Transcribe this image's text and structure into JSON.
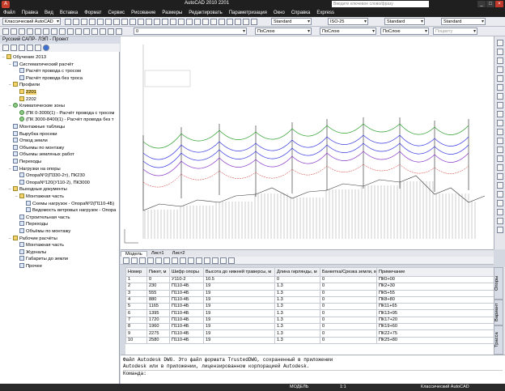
{
  "window": {
    "title": "AutoCAD 2010     2201",
    "search_placeholder": "Введите ключевое слово/фразу"
  },
  "menu": [
    "Файл",
    "Правка",
    "Вид",
    "Вставка",
    "Формат",
    "Сервис",
    "Рисование",
    "Размеры",
    "Редактировать",
    "Параметризация",
    "Окно",
    "Справка",
    "Express"
  ],
  "toolbar": {
    "workspace": "Классический AutoCAD",
    "text_style": "Standard",
    "dim_style": "ISO-25",
    "table_style": "Standard",
    "mleader_style": "Standard",
    "layer": "0",
    "color": "ПоСлою",
    "linetype": "ПоСлою",
    "lineweight": "ПоСлою",
    "plotstyle": "Поцвету"
  },
  "left_panel": {
    "title": "Русский САПР- ЛЭП - Проект",
    "tree": [
      {
        "level": 0,
        "icon": "folder",
        "label": "Обучение 2013",
        "exp": "−"
      },
      {
        "level": 1,
        "icon": "doc",
        "label": "Систематический расчёт",
        "exp": "−"
      },
      {
        "level": 2,
        "icon": "doc",
        "label": "Расчёт провода с тросом",
        "exp": ""
      },
      {
        "level": 2,
        "icon": "doc",
        "label": "Расчёт провода без троса",
        "exp": ""
      },
      {
        "level": 1,
        "icon": "folder",
        "label": "Профили",
        "exp": "−"
      },
      {
        "level": 2,
        "icon": "folder",
        "label": "2201",
        "exp": "",
        "sel": true
      },
      {
        "level": 2,
        "icon": "folder",
        "label": "2202",
        "exp": ""
      },
      {
        "level": 1,
        "icon": "green",
        "label": "Климатические зоны",
        "exp": "−"
      },
      {
        "level": 2,
        "icon": "green",
        "label": "(ПК 0-3000(1) - Расчёт провода с тросом",
        "exp": ""
      },
      {
        "level": 2,
        "icon": "green",
        "label": "(ПК 3000-8400(1) - Расчёт провода без т",
        "exp": ""
      },
      {
        "level": 1,
        "icon": "doc",
        "label": "Монтажные таблицы",
        "exp": ""
      },
      {
        "level": 1,
        "icon": "doc",
        "label": "Вырубка просеки",
        "exp": ""
      },
      {
        "level": 1,
        "icon": "doc",
        "label": "Отвод земли",
        "exp": ""
      },
      {
        "level": 1,
        "icon": "doc",
        "label": "Объемы по монтажу",
        "exp": ""
      },
      {
        "level": 1,
        "icon": "doc",
        "label": "Объемы земляных работ",
        "exp": ""
      },
      {
        "level": 1,
        "icon": "doc",
        "label": "Переходы",
        "exp": ""
      },
      {
        "level": 1,
        "icon": "doc",
        "label": "Нагрузки на опоры",
        "exp": "−"
      },
      {
        "level": 2,
        "icon": "doc",
        "label": "ОпораNº2(П330-2т), ПК230",
        "exp": ""
      },
      {
        "level": 2,
        "icon": "doc",
        "label": "ОпораNº120(У110-2), ПК3000",
        "exp": ""
      },
      {
        "level": 1,
        "icon": "folder",
        "label": "Выходные документы",
        "exp": "−"
      },
      {
        "level": 2,
        "icon": "folder",
        "label": "Монтажная часть",
        "exp": "−"
      },
      {
        "level": 3,
        "icon": "doc",
        "label": "Схемы нагрузок - ОпораNº2(П110-4Б)",
        "exp": ""
      },
      {
        "level": 3,
        "icon": "doc",
        "label": "Ведомость ветровых нагрузок - Опора",
        "exp": ""
      },
      {
        "level": 2,
        "icon": "doc",
        "label": "Строительная часть",
        "exp": ""
      },
      {
        "level": 2,
        "icon": "doc",
        "label": "Переходы",
        "exp": ""
      },
      {
        "level": 2,
        "icon": "doc",
        "label": "Объёмы по монтажу",
        "exp": ""
      },
      {
        "level": 1,
        "icon": "folder",
        "label": "Рабочие расчёты",
        "exp": "−"
      },
      {
        "level": 2,
        "icon": "doc",
        "label": "Монтажная часть",
        "exp": ""
      },
      {
        "level": 2,
        "icon": "doc",
        "label": "Журналы",
        "exp": ""
      },
      {
        "level": 2,
        "icon": "doc",
        "label": "Габариты до земли",
        "exp": ""
      },
      {
        "level": 2,
        "icon": "doc",
        "label": "Прочее",
        "exp": ""
      }
    ]
  },
  "layout_tabs": [
    "Модель",
    "Лист1",
    "Лист2"
  ],
  "table": {
    "headers": [
      "Номер",
      "Пикет, м",
      "Шифр опоры",
      "Высота до нижней траверсы, м",
      "Длина гирлянды, м",
      "Банкетка/Срезка земли, м",
      "Примечание"
    ],
    "rows": [
      [
        "1",
        "0",
        "У110-2",
        "10.5",
        "0",
        "0",
        "ПК0+00"
      ],
      [
        "2",
        "230",
        "П110-4Б",
        "19",
        "1.3",
        "0",
        "ПК2+30"
      ],
      [
        "3",
        "555",
        "П110-4Б",
        "19",
        "1.3",
        "0",
        "ПК5+55"
      ],
      [
        "4",
        "880",
        "П110-4Б",
        "19",
        "1.3",
        "0",
        "ПК8+80"
      ],
      [
        "5",
        "1165",
        "П110-4Б",
        "19",
        "1.3",
        "0",
        "ПК11+65"
      ],
      [
        "6",
        "1395",
        "П110-4Б",
        "19",
        "1.3",
        "0",
        "ПК13+95"
      ],
      [
        "7",
        "1720",
        "П110-4Б",
        "19",
        "1.3",
        "0",
        "ПК17+20"
      ],
      [
        "8",
        "1960",
        "П110-4Б",
        "19",
        "1.3",
        "0",
        "ПК19+60"
      ],
      [
        "9",
        "2275",
        "П110-4Б",
        "19",
        "1.3",
        "0",
        "ПК22+75"
      ],
      [
        "10",
        "2580",
        "П110-4Б",
        "19",
        "1.3",
        "0",
        "ПК25+80"
      ]
    ]
  },
  "side_tabs": [
    "Опоры",
    "Вариант",
    "Трасса"
  ],
  "command": {
    "line1": "Файл Autodesk DWG. Это файл формата TrustedDWG, сохраненный в приложении",
    "line2": "Autodesk или в приложении, лицензированном корпорацией Autodesk.",
    "prompt": "Команда:"
  },
  "status": {
    "model": "МОДЕЛЬ",
    "scale": "1:1",
    "workspace": "Классический AutoCAD"
  },
  "colors": {
    "accent": "#c8402c",
    "green_line": "#2ea02e",
    "blue_line": "#3a3ae0",
    "purple_line": "#8a3ac8",
    "red_line": "#d02020"
  }
}
